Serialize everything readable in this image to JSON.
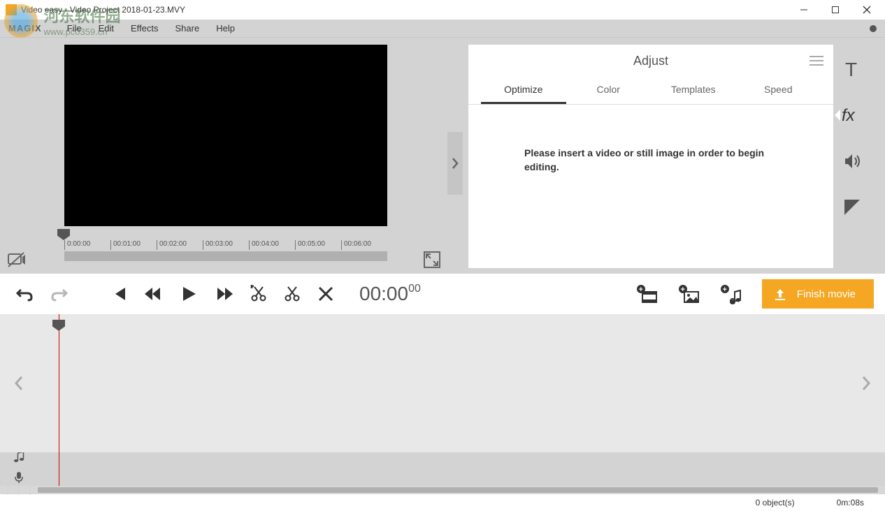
{
  "window": {
    "title": "Video easy - Video Project 2018-01-23.MVY"
  },
  "watermark": {
    "cn": "河东软件园",
    "url": "www.pc0359.cn"
  },
  "logo": "MAGIX",
  "menu": {
    "file": "File",
    "edit": "Edit",
    "effects": "Effects",
    "share": "Share",
    "help": "Help"
  },
  "ruler": {
    "ticks": [
      "0:00:00",
      "00:01:00",
      "00:02:00",
      "00:03:00",
      "00:04:00",
      "00:05:00",
      "00:06:00"
    ]
  },
  "adjust": {
    "title": "Adjust",
    "tabs": {
      "optimize": "Optimize",
      "color": "Color",
      "templates": "Templates",
      "speed": "Speed"
    },
    "message": "Please insert a video or still image in order to begin editing."
  },
  "timecode": {
    "main": "00:00",
    "ms": "00"
  },
  "finish": "Finish movie",
  "status": {
    "objects": "0 object(s)",
    "duration": "0m:08s"
  }
}
